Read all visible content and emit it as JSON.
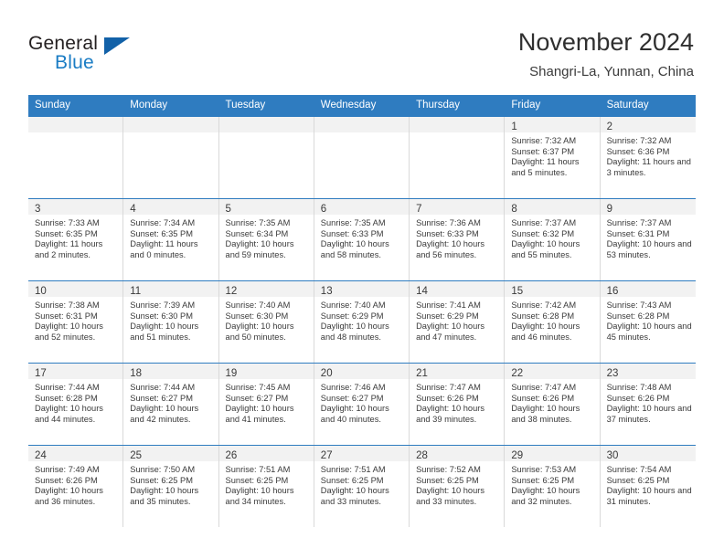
{
  "brand": {
    "name_top": "General",
    "name_bottom": "Blue",
    "accent_color": "#1261a8",
    "text_color": "#231f20"
  },
  "header": {
    "title": "November 2024",
    "subtitle": "Shangri-La, Yunnan, China"
  },
  "theme": {
    "header_blue": "#2f7cc0",
    "daynum_band": "#f2f2f2",
    "cell_border": "#d9d9d9",
    "text": "#3a3a3a"
  },
  "weekdays": [
    "Sunday",
    "Monday",
    "Tuesday",
    "Wednesday",
    "Thursday",
    "Friday",
    "Saturday"
  ],
  "labels": {
    "sunrise": "Sunrise:",
    "sunset": "Sunset:",
    "daylight": "Daylight:"
  },
  "weeks": [
    [
      {
        "day": "",
        "sunrise": "",
        "sunset": "",
        "daylight": ""
      },
      {
        "day": "",
        "sunrise": "",
        "sunset": "",
        "daylight": ""
      },
      {
        "day": "",
        "sunrise": "",
        "sunset": "",
        "daylight": ""
      },
      {
        "day": "",
        "sunrise": "",
        "sunset": "",
        "daylight": ""
      },
      {
        "day": "",
        "sunrise": "",
        "sunset": "",
        "daylight": ""
      },
      {
        "day": "1",
        "sunrise": "Sunrise: 7:32 AM",
        "sunset": "Sunset: 6:37 PM",
        "daylight": "Daylight: 11 hours and 5 minutes."
      },
      {
        "day": "2",
        "sunrise": "Sunrise: 7:32 AM",
        "sunset": "Sunset: 6:36 PM",
        "daylight": "Daylight: 11 hours and 3 minutes."
      }
    ],
    [
      {
        "day": "3",
        "sunrise": "Sunrise: 7:33 AM",
        "sunset": "Sunset: 6:35 PM",
        "daylight": "Daylight: 11 hours and 2 minutes."
      },
      {
        "day": "4",
        "sunrise": "Sunrise: 7:34 AM",
        "sunset": "Sunset: 6:35 PM",
        "daylight": "Daylight: 11 hours and 0 minutes."
      },
      {
        "day": "5",
        "sunrise": "Sunrise: 7:35 AM",
        "sunset": "Sunset: 6:34 PM",
        "daylight": "Daylight: 10 hours and 59 minutes."
      },
      {
        "day": "6",
        "sunrise": "Sunrise: 7:35 AM",
        "sunset": "Sunset: 6:33 PM",
        "daylight": "Daylight: 10 hours and 58 minutes."
      },
      {
        "day": "7",
        "sunrise": "Sunrise: 7:36 AM",
        "sunset": "Sunset: 6:33 PM",
        "daylight": "Daylight: 10 hours and 56 minutes."
      },
      {
        "day": "8",
        "sunrise": "Sunrise: 7:37 AM",
        "sunset": "Sunset: 6:32 PM",
        "daylight": "Daylight: 10 hours and 55 minutes."
      },
      {
        "day": "9",
        "sunrise": "Sunrise: 7:37 AM",
        "sunset": "Sunset: 6:31 PM",
        "daylight": "Daylight: 10 hours and 53 minutes."
      }
    ],
    [
      {
        "day": "10",
        "sunrise": "Sunrise: 7:38 AM",
        "sunset": "Sunset: 6:31 PM",
        "daylight": "Daylight: 10 hours and 52 minutes."
      },
      {
        "day": "11",
        "sunrise": "Sunrise: 7:39 AM",
        "sunset": "Sunset: 6:30 PM",
        "daylight": "Daylight: 10 hours and 51 minutes."
      },
      {
        "day": "12",
        "sunrise": "Sunrise: 7:40 AM",
        "sunset": "Sunset: 6:30 PM",
        "daylight": "Daylight: 10 hours and 50 minutes."
      },
      {
        "day": "13",
        "sunrise": "Sunrise: 7:40 AM",
        "sunset": "Sunset: 6:29 PM",
        "daylight": "Daylight: 10 hours and 48 minutes."
      },
      {
        "day": "14",
        "sunrise": "Sunrise: 7:41 AM",
        "sunset": "Sunset: 6:29 PM",
        "daylight": "Daylight: 10 hours and 47 minutes."
      },
      {
        "day": "15",
        "sunrise": "Sunrise: 7:42 AM",
        "sunset": "Sunset: 6:28 PM",
        "daylight": "Daylight: 10 hours and 46 minutes."
      },
      {
        "day": "16",
        "sunrise": "Sunrise: 7:43 AM",
        "sunset": "Sunset: 6:28 PM",
        "daylight": "Daylight: 10 hours and 45 minutes."
      }
    ],
    [
      {
        "day": "17",
        "sunrise": "Sunrise: 7:44 AM",
        "sunset": "Sunset: 6:28 PM",
        "daylight": "Daylight: 10 hours and 44 minutes."
      },
      {
        "day": "18",
        "sunrise": "Sunrise: 7:44 AM",
        "sunset": "Sunset: 6:27 PM",
        "daylight": "Daylight: 10 hours and 42 minutes."
      },
      {
        "day": "19",
        "sunrise": "Sunrise: 7:45 AM",
        "sunset": "Sunset: 6:27 PM",
        "daylight": "Daylight: 10 hours and 41 minutes."
      },
      {
        "day": "20",
        "sunrise": "Sunrise: 7:46 AM",
        "sunset": "Sunset: 6:27 PM",
        "daylight": "Daylight: 10 hours and 40 minutes."
      },
      {
        "day": "21",
        "sunrise": "Sunrise: 7:47 AM",
        "sunset": "Sunset: 6:26 PM",
        "daylight": "Daylight: 10 hours and 39 minutes."
      },
      {
        "day": "22",
        "sunrise": "Sunrise: 7:47 AM",
        "sunset": "Sunset: 6:26 PM",
        "daylight": "Daylight: 10 hours and 38 minutes."
      },
      {
        "day": "23",
        "sunrise": "Sunrise: 7:48 AM",
        "sunset": "Sunset: 6:26 PM",
        "daylight": "Daylight: 10 hours and 37 minutes."
      }
    ],
    [
      {
        "day": "24",
        "sunrise": "Sunrise: 7:49 AM",
        "sunset": "Sunset: 6:26 PM",
        "daylight": "Daylight: 10 hours and 36 minutes."
      },
      {
        "day": "25",
        "sunrise": "Sunrise: 7:50 AM",
        "sunset": "Sunset: 6:25 PM",
        "daylight": "Daylight: 10 hours and 35 minutes."
      },
      {
        "day": "26",
        "sunrise": "Sunrise: 7:51 AM",
        "sunset": "Sunset: 6:25 PM",
        "daylight": "Daylight: 10 hours and 34 minutes."
      },
      {
        "day": "27",
        "sunrise": "Sunrise: 7:51 AM",
        "sunset": "Sunset: 6:25 PM",
        "daylight": "Daylight: 10 hours and 33 minutes."
      },
      {
        "day": "28",
        "sunrise": "Sunrise: 7:52 AM",
        "sunset": "Sunset: 6:25 PM",
        "daylight": "Daylight: 10 hours and 33 minutes."
      },
      {
        "day": "29",
        "sunrise": "Sunrise: 7:53 AM",
        "sunset": "Sunset: 6:25 PM",
        "daylight": "Daylight: 10 hours and 32 minutes."
      },
      {
        "day": "30",
        "sunrise": "Sunrise: 7:54 AM",
        "sunset": "Sunset: 6:25 PM",
        "daylight": "Daylight: 10 hours and 31 minutes."
      }
    ]
  ]
}
